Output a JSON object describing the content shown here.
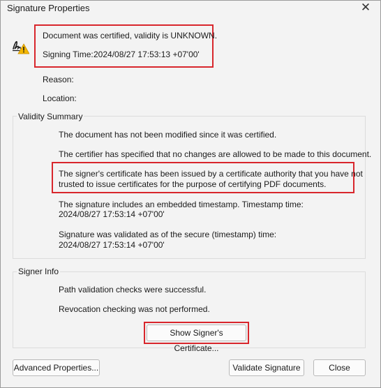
{
  "window": {
    "title": "Signature Properties",
    "close_glyph": "✕"
  },
  "header": {
    "status": "Document was certified, validity is UNKNOWN.",
    "signing_time_label": "Signing Time:",
    "signing_time_value": "2024/08/27 17:53:13 +07'00'",
    "reason_label": "Reason:",
    "location_label": "Location:",
    "icon": "signature-warning-icon"
  },
  "validity_summary": {
    "label": "Validity Summary",
    "lines": [
      "The document has not been modified since it was certified.",
      "The certifier has specified that no changes are allowed to be made to this document.",
      "The signer's certificate has been issued by a certificate authority that you have not",
      "trusted to issue certificates for the purpose of certifying PDF documents.",
      "The signature includes an embedded timestamp. Timestamp time:",
      "2024/08/27 17:53:14 +07'00'",
      "Signature was validated as of the secure (timestamp) time:",
      "2024/08/27 17:53:14 +07'00'"
    ]
  },
  "signer_info": {
    "label": "Signer Info",
    "lines": [
      "Path validation checks were successful.",
      "Revocation checking was not performed."
    ],
    "show_certificate_label": "Show Signer's Certificate..."
  },
  "footer": {
    "advanced_label": "Advanced Properties...",
    "validate_label": "Validate Signature",
    "close_label": "Close"
  },
  "colors": {
    "highlight": "#d8262c",
    "warning": "#f5b800"
  }
}
